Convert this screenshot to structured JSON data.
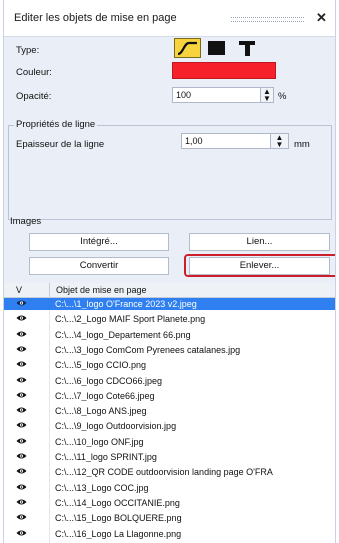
{
  "window": {
    "title": "Editer les objets de mise en page"
  },
  "type": {
    "label": "Type:",
    "options": [
      "line-type-icon",
      "rectangle-type-icon",
      "text-type-icon"
    ]
  },
  "color": {
    "label": "Couleur:",
    "value": "#f5202a"
  },
  "opacity": {
    "label": "Opacité:",
    "value": "100",
    "unit": "%"
  },
  "line_props": {
    "title": "Propriétés de ligne",
    "thickness_label": "Epaisseur de la ligne",
    "thickness_value": "1,00",
    "thickness_unit": "mm"
  },
  "images": {
    "label": "Images",
    "buttons": {
      "integrated": "Intégré...",
      "link": "Lien...",
      "convert": "Convertir",
      "remove": "Enlever..."
    }
  },
  "table": {
    "columns": [
      "V",
      "Objet de mise en page"
    ],
    "rows": [
      "C:\\...\\1_logo O'France 2023 v2.jpeg",
      "C:\\...\\2_Logo MAIF Sport Planete.png",
      "C:\\...\\4_logo_Departement 66.png",
      "C:\\...\\3_logo ComCom Pyrenees catalanes.jpg",
      "C:\\...\\5_logo CCIO.png",
      "C:\\...\\6_logo CDCO66.jpeg",
      "C:\\...\\7_logo Cote66.jpeg",
      "C:\\...\\8_Logo ANS.jpeg",
      "C:\\...\\9_logo Outdoorvision.jpg",
      "C:\\...\\10_logo ONF.jpg",
      "C:\\...\\11_logo SPRINT.jpg",
      "C:\\...\\12_QR CODE outdoorvision landing page O'FRA",
      "C:\\...\\13_Logo COC.jpg",
      "C:\\...\\14_Logo OCCITANIE.png",
      "C:\\...\\15_Logo BOLQUERE.png",
      "C:\\...\\16_Logo La Llagonne.png"
    ]
  }
}
